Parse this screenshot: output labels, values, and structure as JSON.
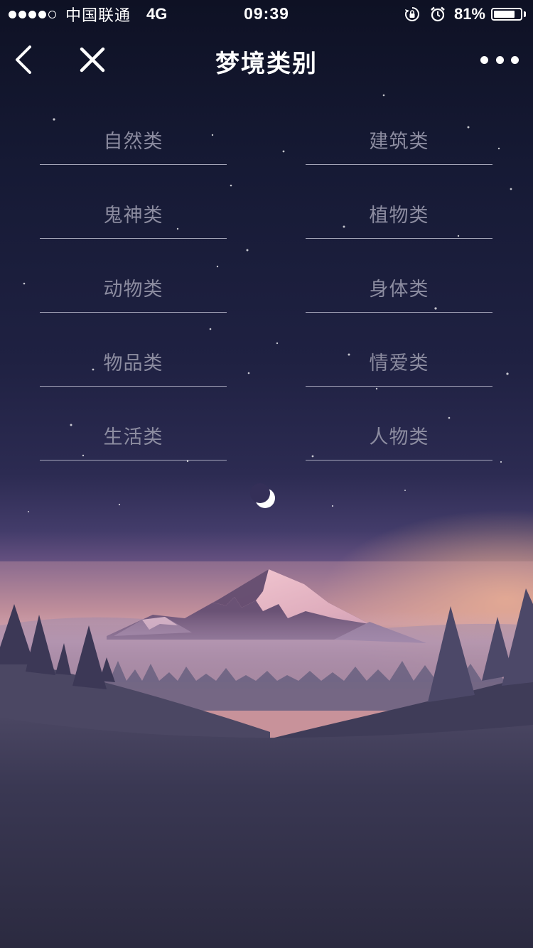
{
  "status_bar": {
    "carrier": "中国联通",
    "network": "4G",
    "time": "09:39",
    "battery_percent": "81%",
    "battery_level": 0.81,
    "signal_strength": 4,
    "signal_max": 5,
    "icons": [
      "orientation-lock-icon",
      "alarm-icon"
    ]
  },
  "nav": {
    "title": "梦境类别",
    "icons": [
      "back-chevron-icon",
      "close-icon",
      "more-dots-icon"
    ]
  },
  "categories": [
    {
      "label": "自然类"
    },
    {
      "label": "建筑类"
    },
    {
      "label": "鬼神类"
    },
    {
      "label": "植物类"
    },
    {
      "label": "动物类"
    },
    {
      "label": "身体类"
    },
    {
      "label": "物品类"
    },
    {
      "label": "情爱类"
    },
    {
      "label": "生活类"
    },
    {
      "label": "人物类"
    }
  ],
  "colors": {
    "sky_top": "#0e1124",
    "sky_mid": "#2a2a50",
    "horizon_glow": "#e8a88a",
    "ground": "#2d2c44",
    "category_text": "#8c8ca0",
    "category_line": "#d2d2e1"
  }
}
